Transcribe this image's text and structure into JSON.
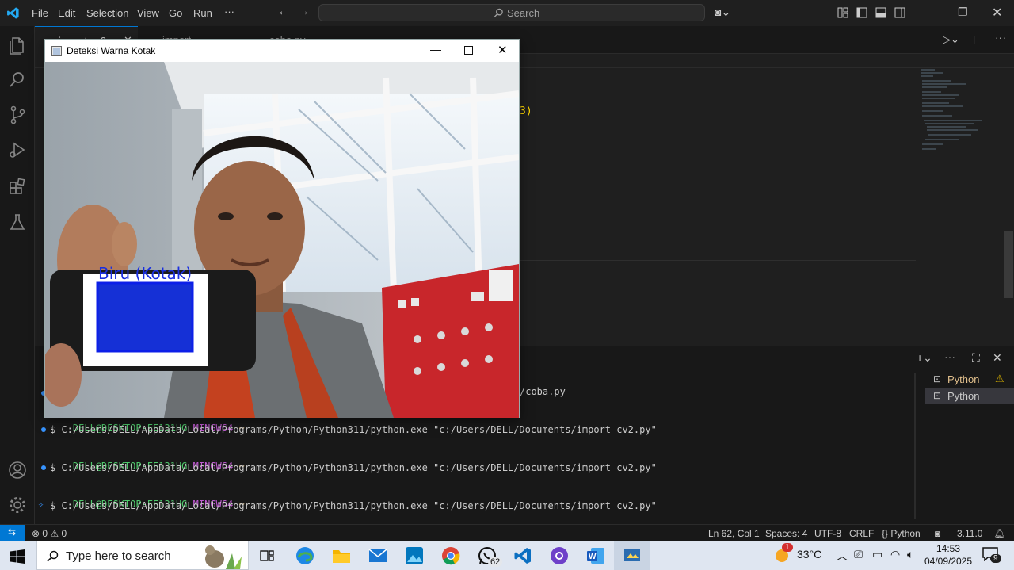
{
  "titlebar": {
    "menu": [
      "File",
      "Edit",
      "Selection",
      "View",
      "Go",
      "Run",
      "···"
    ],
    "search_placeholder": "Search"
  },
  "tabs": [
    "import cv2.py",
    "import pyautogui.py",
    "coba.py"
  ],
  "editor": {
    "visible_code_fragment": "3)"
  },
  "camera_window": {
    "title": "Deteksi Warna Kotak",
    "detection_label": "Biru (Kotak)",
    "colors": {
      "box": "#1530d6",
      "label": "#1a2fe0"
    }
  },
  "terminal": {
    "partial_line": "/coba.py",
    "lines": [
      {
        "prompt_user": "DELL@DESKTOP-EE131HG",
        "prompt_env": "MINGW64",
        "prompt_path": "~"
      },
      {
        "command": "$ C:/Users/DELL/AppData/Local/Programs/Python/Python311/python.exe \"c:/Users/DELL/Documents/import cv2.py\""
      },
      {
        "prompt_user": "DELL@DESKTOP-EE131HG",
        "prompt_env": "MINGW64",
        "prompt_path": "~"
      },
      {
        "command": "$ C:/Users/DELL/AppData/Local/Programs/Python/Python311/python.exe \"c:/Users/DELL/Documents/import cv2.py\""
      },
      {
        "prompt_user": "DELL@DESKTOP-EE131HG",
        "prompt_env": "MINGW64",
        "prompt_path": "~"
      },
      {
        "command": "$ C:/Users/DELL/AppData/Local/Programs/Python/Python311/python.exe \"c:/Users/DELL/Documents/import cv2.py\""
      }
    ],
    "sessions": [
      "Python",
      "Python"
    ]
  },
  "statusbar": {
    "errors": "0",
    "warnings": "0",
    "position": "Ln 62, Col 1",
    "spaces": "Spaces: 4",
    "encoding": "UTF-8",
    "eol": "CRLF",
    "language": "Python",
    "version": "3.11.0"
  },
  "taskbar": {
    "search_placeholder": "Type here to search",
    "whatsapp_badge": "62",
    "temperature": "33°C",
    "weather_badge": "1",
    "time": "14:53",
    "date": "04/09/2025",
    "notifications": "9"
  }
}
